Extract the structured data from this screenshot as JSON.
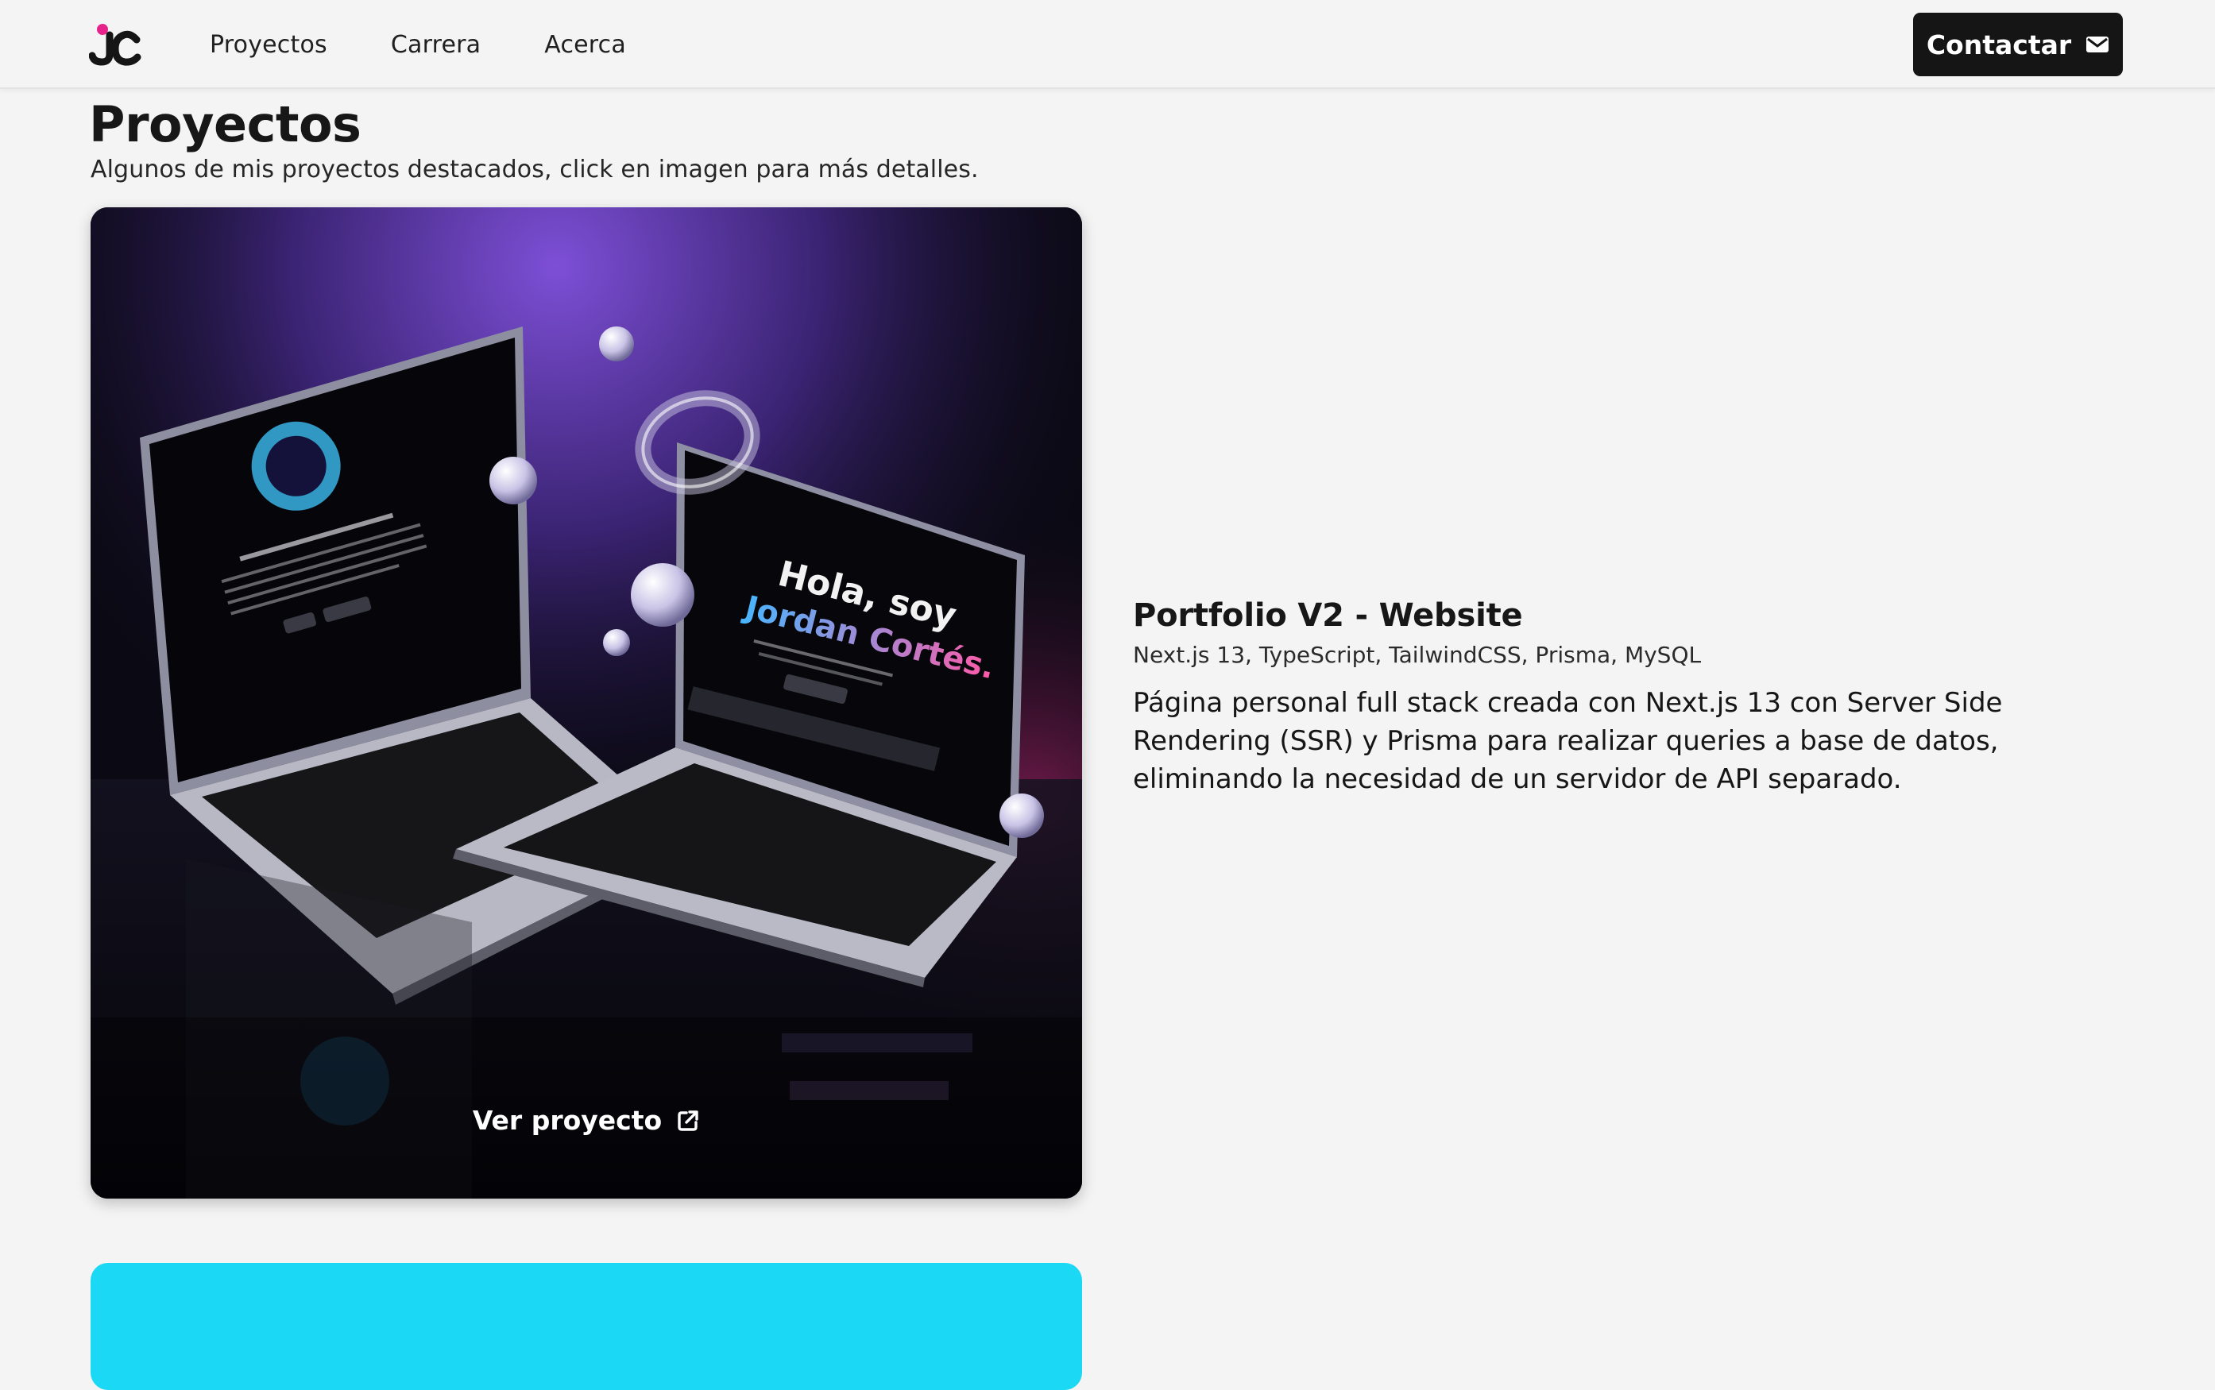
{
  "header": {
    "logo_text": "JC",
    "nav": [
      "Proyectos",
      "Carrera",
      "Acerca"
    ],
    "contact_label": "Contactar"
  },
  "section": {
    "title": "Proyectos",
    "subtitle": "Algunos de mis proyectos destacados, click en imagen para más detalles."
  },
  "project": {
    "title": "Portfolio V2 - Website",
    "tech": "Next.js 13, TypeScript, TailwindCSS, Prisma, MySQL",
    "description": "Página personal full stack creada con Next.js 13 con Server Side Rendering (SSR) y Prisma para realizar queries a base de datos, eliminando la necesidad de un servidor de API separado.",
    "view_label": "Ver proyecto",
    "screen": {
      "hero_line1": "Hola, soy",
      "hero_line2": "Jordan Cortés."
    }
  },
  "colors": {
    "brand_dark": "#151515",
    "logo_accent": "#e5238a",
    "next_card": "#1bd8f4"
  }
}
